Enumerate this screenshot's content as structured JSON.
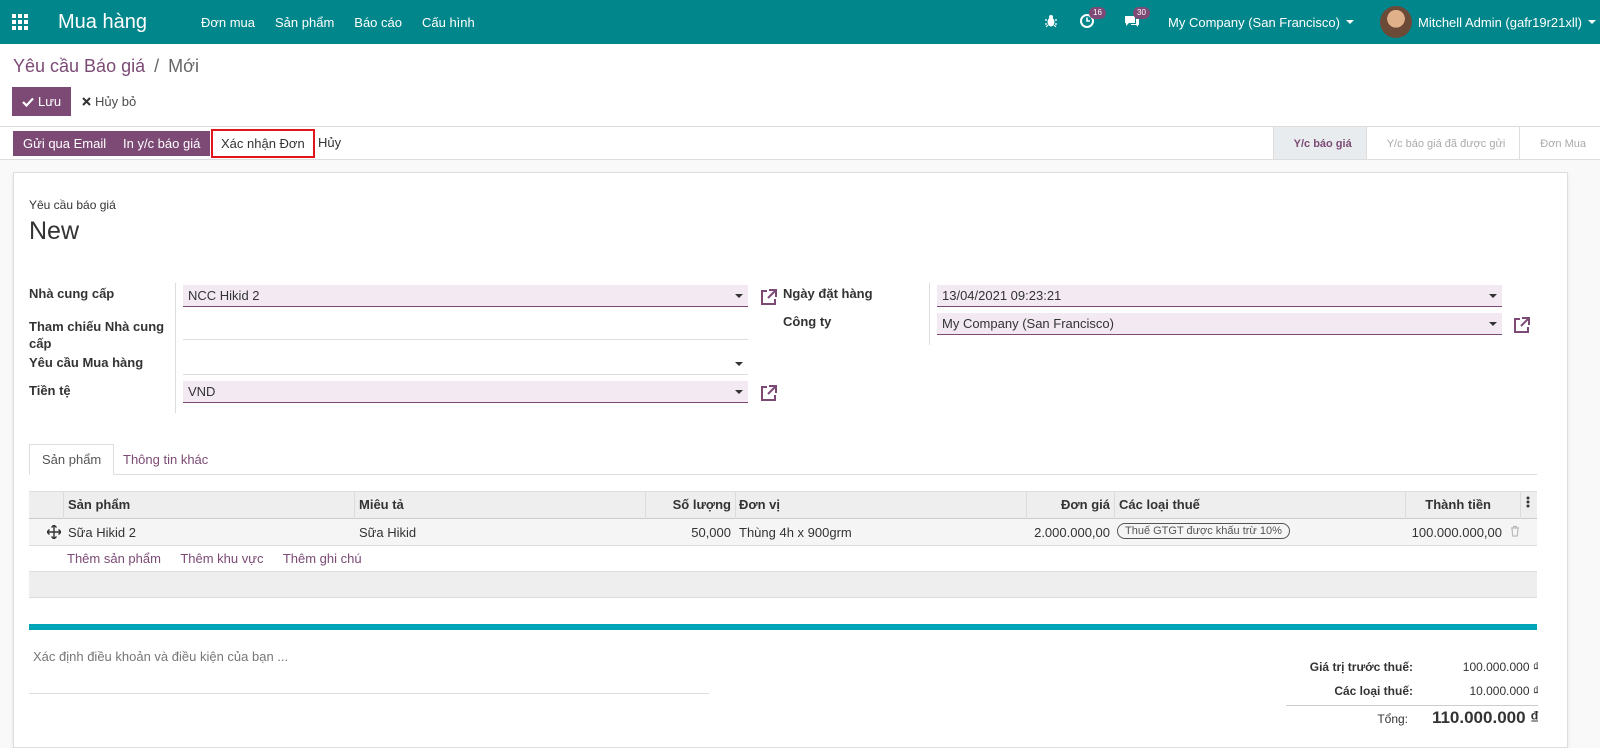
{
  "navbar": {
    "app_name": "Mua hàng",
    "menu": [
      "Đơn mua",
      "Sản phẩm",
      "Báo cáo",
      "Cấu hình"
    ],
    "activity_count": "16",
    "message_count": "30",
    "company": "My Company (San Francisco)",
    "user": "Mitchell Admin (gafr19r21xll)",
    "bg_color": "#00868b"
  },
  "breadcrumb": {
    "parent": "Yêu cầu Báo giá",
    "separator": "/",
    "current": "Mới"
  },
  "actions": {
    "save": "Lưu",
    "discard": "Hủy bỏ"
  },
  "statusbar": {
    "send_email": "Gửi qua Email",
    "print_rfq": "In y/c báo giá",
    "confirm_order": "Xác nhận Đơn",
    "cancel": "Hủy",
    "stages": [
      "Y/c báo giá",
      "Y/c báo giá đã được gửi",
      "Đơn Mua"
    ],
    "active_stage": "Y/c báo giá"
  },
  "form": {
    "title_label": "Yêu cầu báo giá",
    "title": "New",
    "vendor_label": "Nhà cung cấp",
    "vendor_value": "NCC Hikid 2",
    "vendor_ref_label": "Tham chiếu Nhà cung cấp",
    "vendor_ref_value": "",
    "requisition_label": "Yêu cầu Mua hàng",
    "requisition_value": "",
    "currency_label": "Tiền tệ",
    "currency_value": "VND",
    "order_date_label": "Ngày đặt hàng",
    "order_date_value": "13/04/2021 09:23:21",
    "company_label": "Công ty",
    "company_value": "My Company (San Francisco)"
  },
  "tabs": [
    "Sản phẩm",
    "Thông tin khác"
  ],
  "table": {
    "columns": [
      "Sản phẩm",
      "Miêu tả",
      "Số lượng",
      "Đơn vị",
      "Đơn giá",
      "Các loại thuế",
      "Thành tiền"
    ],
    "rows": [
      {
        "product": "Sữa Hikid 2",
        "description": "Sữa Hikid",
        "quantity": "50,000",
        "uom": "Thùng 4h x 900grm",
        "unit_price": "2.000.000,00",
        "tax": "Thuế GTGT được khấu trừ 10%",
        "subtotal": "100.000.000,00"
      }
    ],
    "add_links": [
      "Thêm sản phẩm",
      "Thêm khu vực",
      "Thêm ghi chú"
    ]
  },
  "notes_placeholder": "Xác định điều khoản và điều kiện của bạn ...",
  "totals": {
    "untaxed_label": "Giá trị trước thuế:",
    "untaxed_value": "100.000.000 ₫",
    "taxes_label": "Các loại thuế:",
    "taxes_value": "10.000.000 ₫",
    "total_label": "Tổng:",
    "total_value": "110.000.000 ₫"
  },
  "colors": {
    "accent": "#7c4a75",
    "teal": "#00868b",
    "highlight_border": "#e0161b"
  }
}
